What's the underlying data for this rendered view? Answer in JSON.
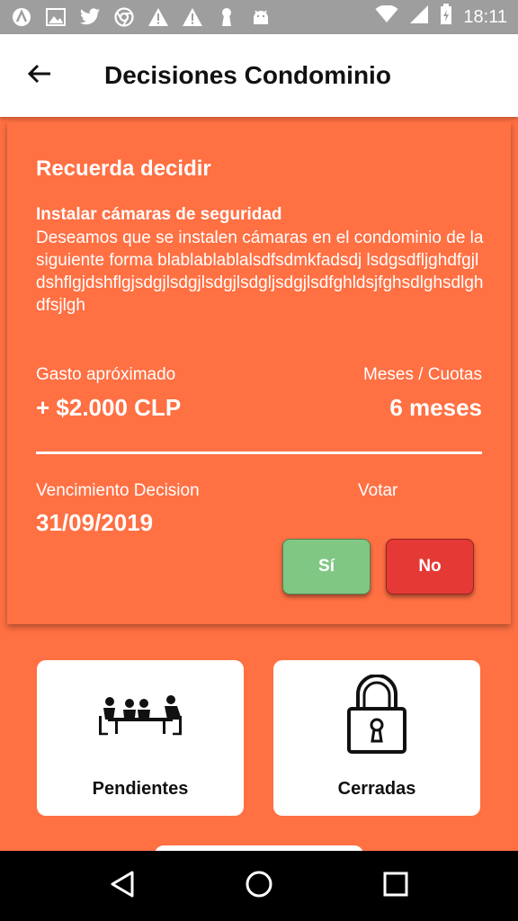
{
  "status_bar": {
    "time": "18:11",
    "left_icons": [
      "app-a-icon",
      "image-icon",
      "twitter-icon",
      "chrome-icon",
      "warning-icon",
      "warning-icon",
      "keyhole-icon",
      "android-icon"
    ],
    "right_icons": [
      "wifi-icon",
      "signal-icon",
      "battery-icon"
    ]
  },
  "app_bar": {
    "title": "Decisiones Condominio",
    "back_icon": "arrow-back-icon"
  },
  "decision": {
    "heading": "Recuerda decidir",
    "title": "Instalar cámaras de seguridad",
    "description": "Deseamos que se instalen cámaras en el condominio de la siguiente forma blablablablalsdfsdmkfadsdj lsdgsdfljghdfgjldshflgjdshflgjsdgjlsdgjlsdgjlsdgljsdgjlsdfghldsjfghsdlghsdlghdfsjlgh",
    "cost_label": "Gasto apróximado",
    "cost_value": "+ $2.000 CLP",
    "months_label": "Meses / Cuotas",
    "months_value": "6 meses",
    "due_label": "Vencimiento Decision",
    "due_value": "31/09/2019",
    "vote_label": "Votar",
    "yes_label": "Sí",
    "no_label": "No"
  },
  "tiles": [
    {
      "label": "Pendientes",
      "icon": "meeting-icon"
    },
    {
      "label": "Cerradas",
      "icon": "lock-icon"
    }
  ],
  "nav_bar": {
    "icons": [
      "back-triangle-icon",
      "home-circle-icon",
      "recents-square-icon"
    ]
  },
  "colors": {
    "accent": "#ff7043",
    "yes": "#81c784",
    "no": "#e53935",
    "status_bar": "#9e9e9e"
  }
}
